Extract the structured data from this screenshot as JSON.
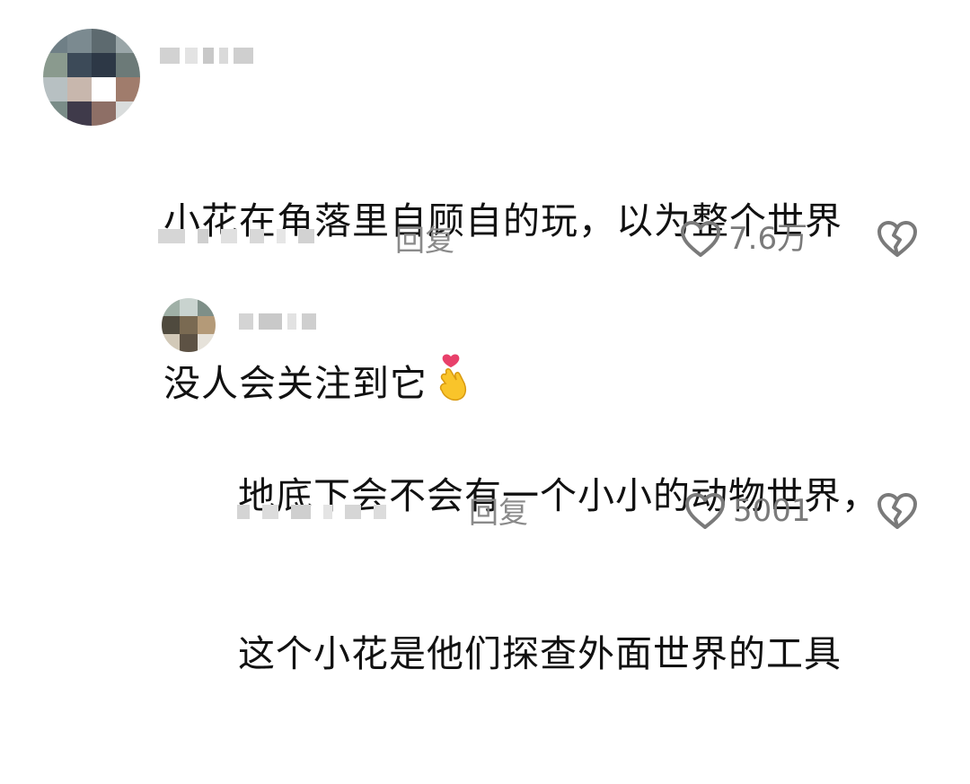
{
  "comments": [
    {
      "text_line1": "小花在角落里自顾自的玩，以为整个世界",
      "text_line2": "没人会关注到它",
      "emoji": "finger-heart-emoji",
      "reply_label": "回复",
      "like_count": "7.6万",
      "icons": {
        "like": "heart-outline-icon",
        "dislike": "broken-heart-icon"
      }
    },
    {
      "text_line1": "地底下会不会有一个小小的动物世界，",
      "text_line2": "这个小花是他们探查外面世界的工具",
      "reply_label": "回复",
      "like_count": "5001",
      "icons": {
        "like": "heart-outline-icon",
        "dislike": "broken-heart-icon"
      }
    }
  ],
  "colors": {
    "text": "#111111",
    "secondary": "#8a8a8a",
    "icon": "#7a7a7a"
  }
}
